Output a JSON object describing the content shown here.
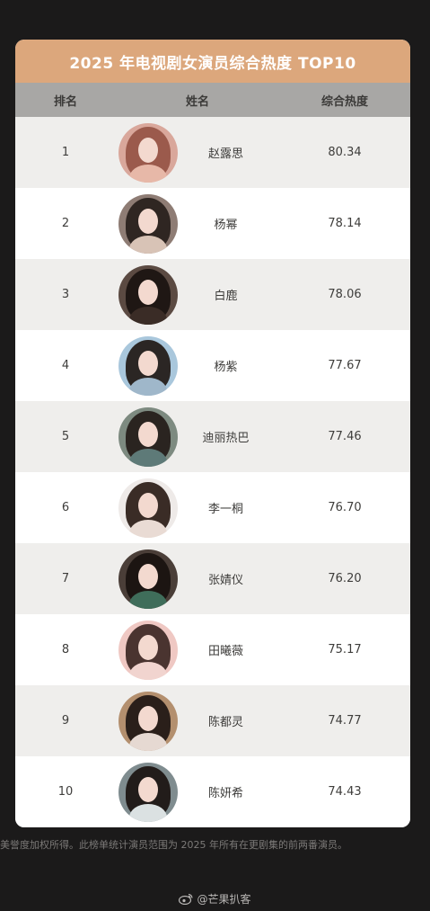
{
  "title": "2025 年电视剧女演员综合热度 TOP10",
  "headers": {
    "rank": "排名",
    "name": "姓名",
    "score": "综合热度"
  },
  "rows": [
    {
      "rank": "1",
      "name": "赵露思",
      "score": "80.34"
    },
    {
      "rank": "2",
      "name": "杨幂",
      "score": "78.14"
    },
    {
      "rank": "3",
      "name": "白鹿",
      "score": "78.06"
    },
    {
      "rank": "4",
      "name": "杨紫",
      "score": "77.67"
    },
    {
      "rank": "5",
      "name": "迪丽热巴",
      "score": "77.46"
    },
    {
      "rank": "6",
      "name": "李一桐",
      "score": "76.70"
    },
    {
      "rank": "7",
      "name": "张婧仪",
      "score": "76.20"
    },
    {
      "rank": "8",
      "name": "田曦薇",
      "score": "75.17"
    },
    {
      "rank": "9",
      "name": "陈都灵",
      "score": "74.77"
    },
    {
      "rank": "10",
      "name": "陈妍希",
      "score": "74.43"
    }
  ],
  "footnote": "美誉度加权所得。此榜单统计演员范围为 2025 年所有在更剧集的前两番演员。",
  "watermark": "@芒果扒客",
  "colors": {
    "title_bar": "#dca77c",
    "header_bar": "#a8a7a5",
    "row_alt": "#efeeec",
    "page_bg": "#1b1a1a"
  },
  "avatar_tones": [
    {
      "bg": "#d9a79b",
      "hair": "#9b5a4c",
      "body": "#e7b8a8"
    },
    {
      "bg": "#8e7c74",
      "hair": "#2f2622",
      "body": "#d8c3b6"
    },
    {
      "bg": "#5b4a42",
      "hair": "#1f1714",
      "body": "#3a2c26"
    },
    {
      "bg": "#a9c7dc",
      "hair": "#2b2624",
      "body": "#9fb7ca"
    },
    {
      "bg": "#7d8a80",
      "hair": "#2a2420",
      "body": "#5e7a78"
    },
    {
      "bg": "#eeeae8",
      "hair": "#3a2c26",
      "body": "#e9dbd4"
    },
    {
      "bg": "#4a3e38",
      "hair": "#1c1512",
      "body": "#3f6d5a"
    },
    {
      "bg": "#efc8c3",
      "hair": "#4a3430",
      "body": "#f1d4cf"
    },
    {
      "bg": "#b38f6e",
      "hair": "#2a1f1a",
      "body": "#e6d9d2"
    },
    {
      "bg": "#7f8c8f",
      "hair": "#221c1a",
      "body": "#dbe1e2"
    }
  ]
}
